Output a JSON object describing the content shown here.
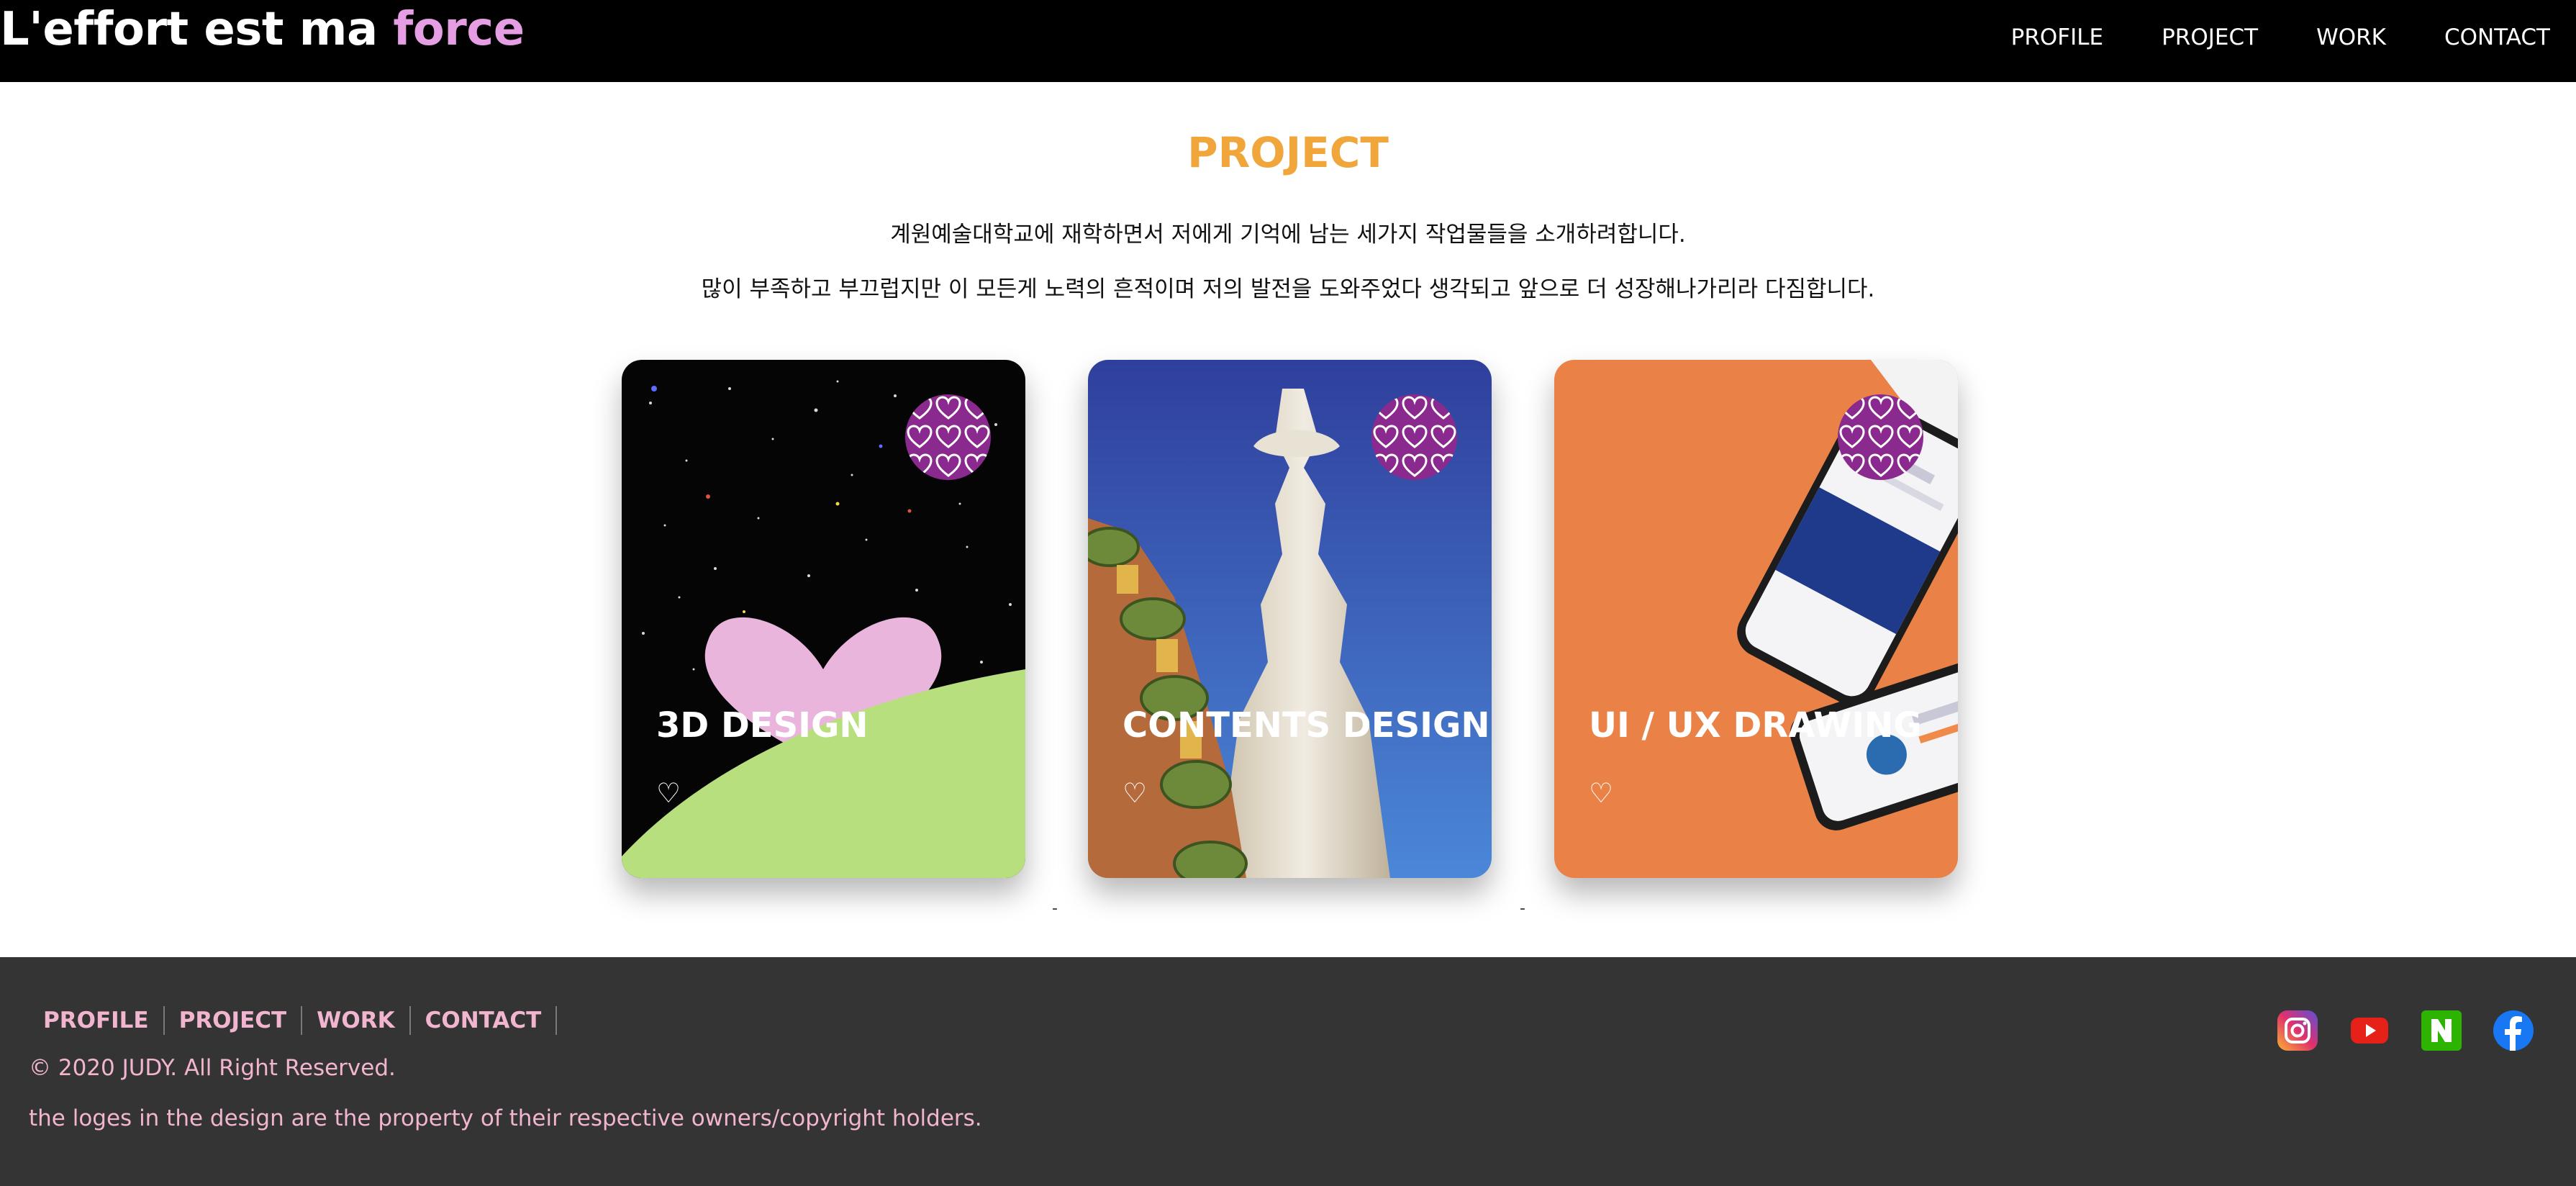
{
  "header": {
    "logo_main": "L'effort est ma ",
    "logo_accent": "force",
    "nav": [
      "PROFILE",
      "PROJECT",
      "WORK",
      "CONTACT"
    ]
  },
  "section": {
    "title": "PROJECT",
    "intro_line1": "계원예술대학교에 재학하면서 저에게 기억에 남는 세가지 작업물들을 소개하려합니다.",
    "intro_line2": "많이 부족하고 부끄럽지만 이 모든게 노력의 흔적이며 저의 발전을 도와주었다 생각되고 앞으로 더 성장해나가리라 다짐합니다."
  },
  "cards": [
    {
      "title": "3D DESIGN",
      "like": "♡"
    },
    {
      "title": "CONTENTS DESIGN",
      "like": "♡"
    },
    {
      "title": "UI / UX DRAWING",
      "like": "♡"
    }
  ],
  "footer": {
    "nav": [
      "PROFILE",
      "PROJECT",
      "WORK",
      "CONTACT"
    ],
    "copyright": "© 2020 JUDY. All Right Reserved.",
    "disclaimer": "the loges in the design are the property of their respective owners/copyright holders.",
    "social_icons": [
      "instagram-icon",
      "youtube-icon",
      "naver-icon",
      "facebook-icon"
    ]
  },
  "colors": {
    "accent_pink": "#e59ee3",
    "title_orange": "#f0a63b",
    "footer_text": "#f2b5cf",
    "footer_bg": "#343434",
    "heart_badge": "#8b2a8e"
  }
}
